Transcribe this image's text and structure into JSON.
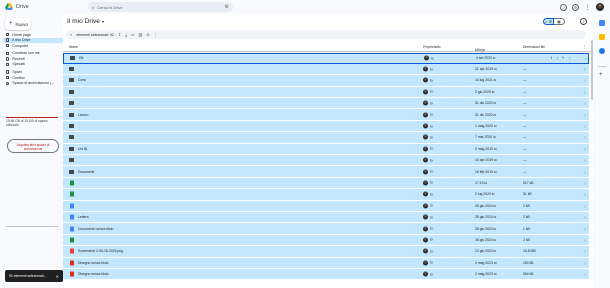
{
  "app": {
    "name": "Drive"
  },
  "search": {
    "placeholder": "Cerca in Drive"
  },
  "header": {
    "title": "Il mio Drive",
    "title_caret": "▾"
  },
  "new_button": {
    "label": "Nuovo",
    "plus": "+"
  },
  "sidebar": {
    "items": [
      {
        "label": "Home page",
        "active": false
      },
      {
        "label": "Il mio Drive",
        "active": true
      },
      {
        "label": "Computer",
        "active": false
      },
      {
        "label": "Condivisi con me",
        "active": false
      },
      {
        "label": "Recenti",
        "active": false
      },
      {
        "label": "Speciali",
        "active": false
      },
      {
        "label": "Spam",
        "active": false
      },
      {
        "label": "Cestino",
        "active": false
      },
      {
        "label": "Spazio di archiviazione (...",
        "active": false
      }
    ],
    "storage_text": "15,66 GB di 15 GB di spazio utilizzato",
    "storage_fraction": 1.0,
    "storage_button": "Acquista altro spazio di archiviazione"
  },
  "snackbar": {
    "text": "92 elementi selezionati..."
  },
  "selection_bar": {
    "close": "×",
    "count_text": "elementi selezionati: 92"
  },
  "table": {
    "headers": {
      "name": "Nome",
      "owner": "Proprietario",
      "modified": "Ultima modifica",
      "sort_arrow": "↓",
      "size": "Dimensioni file"
    },
    "rows": [
      {
        "type": "folder",
        "name": "Git",
        "owner": "io",
        "date": "4 set 2020 io",
        "size": "—"
      },
      {
        "type": "folder",
        "name": "",
        "owner": "io",
        "date": "21 apr 2019 io",
        "size": "—"
      },
      {
        "type": "folder",
        "name": "Corsi",
        "owner": "io",
        "date": "14 lug 2021 io",
        "size": "—"
      },
      {
        "type": "folder",
        "name": "",
        "owner": "io",
        "date": "2 giu 2020 io",
        "size": "—"
      },
      {
        "type": "folder",
        "name": "",
        "owner": "io",
        "date": "31 dic 2020 io",
        "size": "—"
      },
      {
        "type": "folder",
        "name": "Lavoro",
        "owner": "io",
        "date": "31 dic 2020 io",
        "size": "—"
      },
      {
        "type": "folder",
        "name": "",
        "owner": "io",
        "date": "1 mag 2020 io",
        "size": "—"
      },
      {
        "type": "folder",
        "name": "",
        "owner": "io",
        "date": "7 mar 2020 io",
        "size": "—"
      },
      {
        "type": "folder",
        "name": "Uni BL",
        "owner": "io",
        "date": "2 mag 2019 io",
        "size": "—"
      },
      {
        "type": "folder",
        "name": "",
        "owner": "io",
        "date": "10 apr 2019 io",
        "size": "—"
      },
      {
        "type": "folder",
        "name": "Documenti",
        "owner": "io",
        "date": "16 feb 2019 io",
        "size": "—"
      },
      {
        "type": "sheet",
        "name": "",
        "owner": "io",
        "date": "17:19 io",
        "size": "517 kB"
      },
      {
        "type": "sheet",
        "name": "",
        "owner": "io",
        "date": "2 lug 2024 io",
        "size": "31 kB"
      },
      {
        "type": "doc",
        "name": "",
        "owner": "io",
        "date": "28 giu 2024 io",
        "size": "2 kB"
      },
      {
        "type": "doc",
        "name": "Lettera",
        "owner": "io",
        "date": "28 giu 2024 io",
        "size": "2 kB"
      },
      {
        "type": "doc",
        "name": "Documento senza titolo",
        "owner": "io",
        "date": "28 giu 2024 io",
        "size": "1 kB"
      },
      {
        "type": "sheet",
        "name": "",
        "owner": "io",
        "date": "28 giu 2024 io",
        "size": "2 kB"
      },
      {
        "type": "img",
        "name": "Screenshot 2-06-16-2024.png",
        "owner": "io",
        "date": "12 giu 2024 io",
        "size": "15,8 MB"
      },
      {
        "type": "draw",
        "name": "Disegno senza titolo",
        "owner": "io",
        "date": "2 mag 2023 io",
        "size": "150 kB"
      },
      {
        "type": "draw",
        "name": "Disegno senza titolo",
        "owner": "io",
        "date": "2 mag 2023 io",
        "size": "564 kB"
      }
    ]
  },
  "colors": {
    "selected_row": "#c2e7ff",
    "accent": "#0b57d0"
  }
}
